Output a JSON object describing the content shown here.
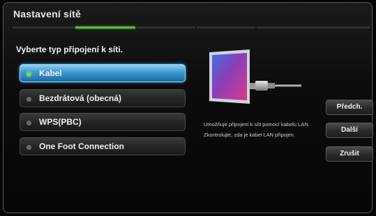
{
  "dialog": {
    "title": "Nastavení sítě",
    "steps_total": 5,
    "active_step": 2
  },
  "prompt": "Vyberte typ připojení k síti.",
  "options": [
    {
      "label": "Kabel",
      "selected": true
    },
    {
      "label": "Bezdrátová (obecná)",
      "selected": false
    },
    {
      "label": "WPS(PBC)",
      "selected": false
    },
    {
      "label": "One Foot Connection",
      "selected": false
    }
  ],
  "description": "Umožňuje připojení k síti pomocí kabelu LAN. Zkontrolujte, zda je kabel LAN připojen.",
  "buttons": {
    "prev": "Předch.",
    "next": "Další",
    "cancel": "Zrušit"
  },
  "colors": {
    "selection": "#3d98cf",
    "progress_active": "#5cba3c",
    "indicator_selected": "#6fd65a"
  },
  "icons": [
    "network-cable-illustration-icon",
    "radio-dot-icon"
  ]
}
